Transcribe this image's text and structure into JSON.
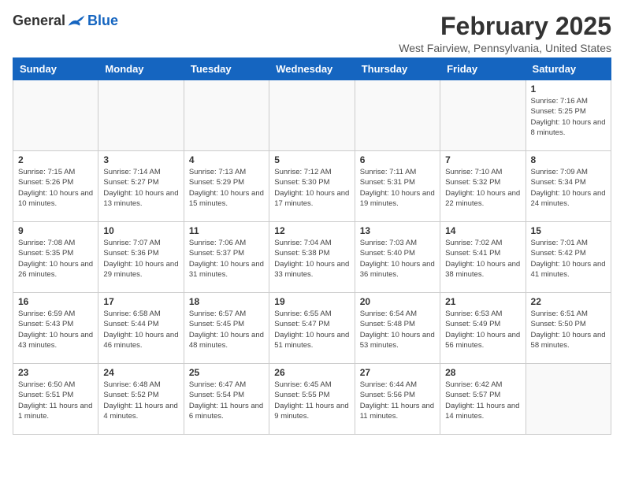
{
  "header": {
    "logo_general": "General",
    "logo_blue": "Blue",
    "month_year": "February 2025",
    "location": "West Fairview, Pennsylvania, United States"
  },
  "weekdays": [
    "Sunday",
    "Monday",
    "Tuesday",
    "Wednesday",
    "Thursday",
    "Friday",
    "Saturday"
  ],
  "weeks": [
    [
      {
        "day": "",
        "detail": ""
      },
      {
        "day": "",
        "detail": ""
      },
      {
        "day": "",
        "detail": ""
      },
      {
        "day": "",
        "detail": ""
      },
      {
        "day": "",
        "detail": ""
      },
      {
        "day": "",
        "detail": ""
      },
      {
        "day": "1",
        "detail": "Sunrise: 7:16 AM\nSunset: 5:25 PM\nDaylight: 10 hours and 8 minutes."
      }
    ],
    [
      {
        "day": "2",
        "detail": "Sunrise: 7:15 AM\nSunset: 5:26 PM\nDaylight: 10 hours and 10 minutes."
      },
      {
        "day": "3",
        "detail": "Sunrise: 7:14 AM\nSunset: 5:27 PM\nDaylight: 10 hours and 13 minutes."
      },
      {
        "day": "4",
        "detail": "Sunrise: 7:13 AM\nSunset: 5:29 PM\nDaylight: 10 hours and 15 minutes."
      },
      {
        "day": "5",
        "detail": "Sunrise: 7:12 AM\nSunset: 5:30 PM\nDaylight: 10 hours and 17 minutes."
      },
      {
        "day": "6",
        "detail": "Sunrise: 7:11 AM\nSunset: 5:31 PM\nDaylight: 10 hours and 19 minutes."
      },
      {
        "day": "7",
        "detail": "Sunrise: 7:10 AM\nSunset: 5:32 PM\nDaylight: 10 hours and 22 minutes."
      },
      {
        "day": "8",
        "detail": "Sunrise: 7:09 AM\nSunset: 5:34 PM\nDaylight: 10 hours and 24 minutes."
      }
    ],
    [
      {
        "day": "9",
        "detail": "Sunrise: 7:08 AM\nSunset: 5:35 PM\nDaylight: 10 hours and 26 minutes."
      },
      {
        "day": "10",
        "detail": "Sunrise: 7:07 AM\nSunset: 5:36 PM\nDaylight: 10 hours and 29 minutes."
      },
      {
        "day": "11",
        "detail": "Sunrise: 7:06 AM\nSunset: 5:37 PM\nDaylight: 10 hours and 31 minutes."
      },
      {
        "day": "12",
        "detail": "Sunrise: 7:04 AM\nSunset: 5:38 PM\nDaylight: 10 hours and 33 minutes."
      },
      {
        "day": "13",
        "detail": "Sunrise: 7:03 AM\nSunset: 5:40 PM\nDaylight: 10 hours and 36 minutes."
      },
      {
        "day": "14",
        "detail": "Sunrise: 7:02 AM\nSunset: 5:41 PM\nDaylight: 10 hours and 38 minutes."
      },
      {
        "day": "15",
        "detail": "Sunrise: 7:01 AM\nSunset: 5:42 PM\nDaylight: 10 hours and 41 minutes."
      }
    ],
    [
      {
        "day": "16",
        "detail": "Sunrise: 6:59 AM\nSunset: 5:43 PM\nDaylight: 10 hours and 43 minutes."
      },
      {
        "day": "17",
        "detail": "Sunrise: 6:58 AM\nSunset: 5:44 PM\nDaylight: 10 hours and 46 minutes."
      },
      {
        "day": "18",
        "detail": "Sunrise: 6:57 AM\nSunset: 5:45 PM\nDaylight: 10 hours and 48 minutes."
      },
      {
        "day": "19",
        "detail": "Sunrise: 6:55 AM\nSunset: 5:47 PM\nDaylight: 10 hours and 51 minutes."
      },
      {
        "day": "20",
        "detail": "Sunrise: 6:54 AM\nSunset: 5:48 PM\nDaylight: 10 hours and 53 minutes."
      },
      {
        "day": "21",
        "detail": "Sunrise: 6:53 AM\nSunset: 5:49 PM\nDaylight: 10 hours and 56 minutes."
      },
      {
        "day": "22",
        "detail": "Sunrise: 6:51 AM\nSunset: 5:50 PM\nDaylight: 10 hours and 58 minutes."
      }
    ],
    [
      {
        "day": "23",
        "detail": "Sunrise: 6:50 AM\nSunset: 5:51 PM\nDaylight: 11 hours and 1 minute."
      },
      {
        "day": "24",
        "detail": "Sunrise: 6:48 AM\nSunset: 5:52 PM\nDaylight: 11 hours and 4 minutes."
      },
      {
        "day": "25",
        "detail": "Sunrise: 6:47 AM\nSunset: 5:54 PM\nDaylight: 11 hours and 6 minutes."
      },
      {
        "day": "26",
        "detail": "Sunrise: 6:45 AM\nSunset: 5:55 PM\nDaylight: 11 hours and 9 minutes."
      },
      {
        "day": "27",
        "detail": "Sunrise: 6:44 AM\nSunset: 5:56 PM\nDaylight: 11 hours and 11 minutes."
      },
      {
        "day": "28",
        "detail": "Sunrise: 6:42 AM\nSunset: 5:57 PM\nDaylight: 11 hours and 14 minutes."
      },
      {
        "day": "",
        "detail": ""
      }
    ]
  ]
}
